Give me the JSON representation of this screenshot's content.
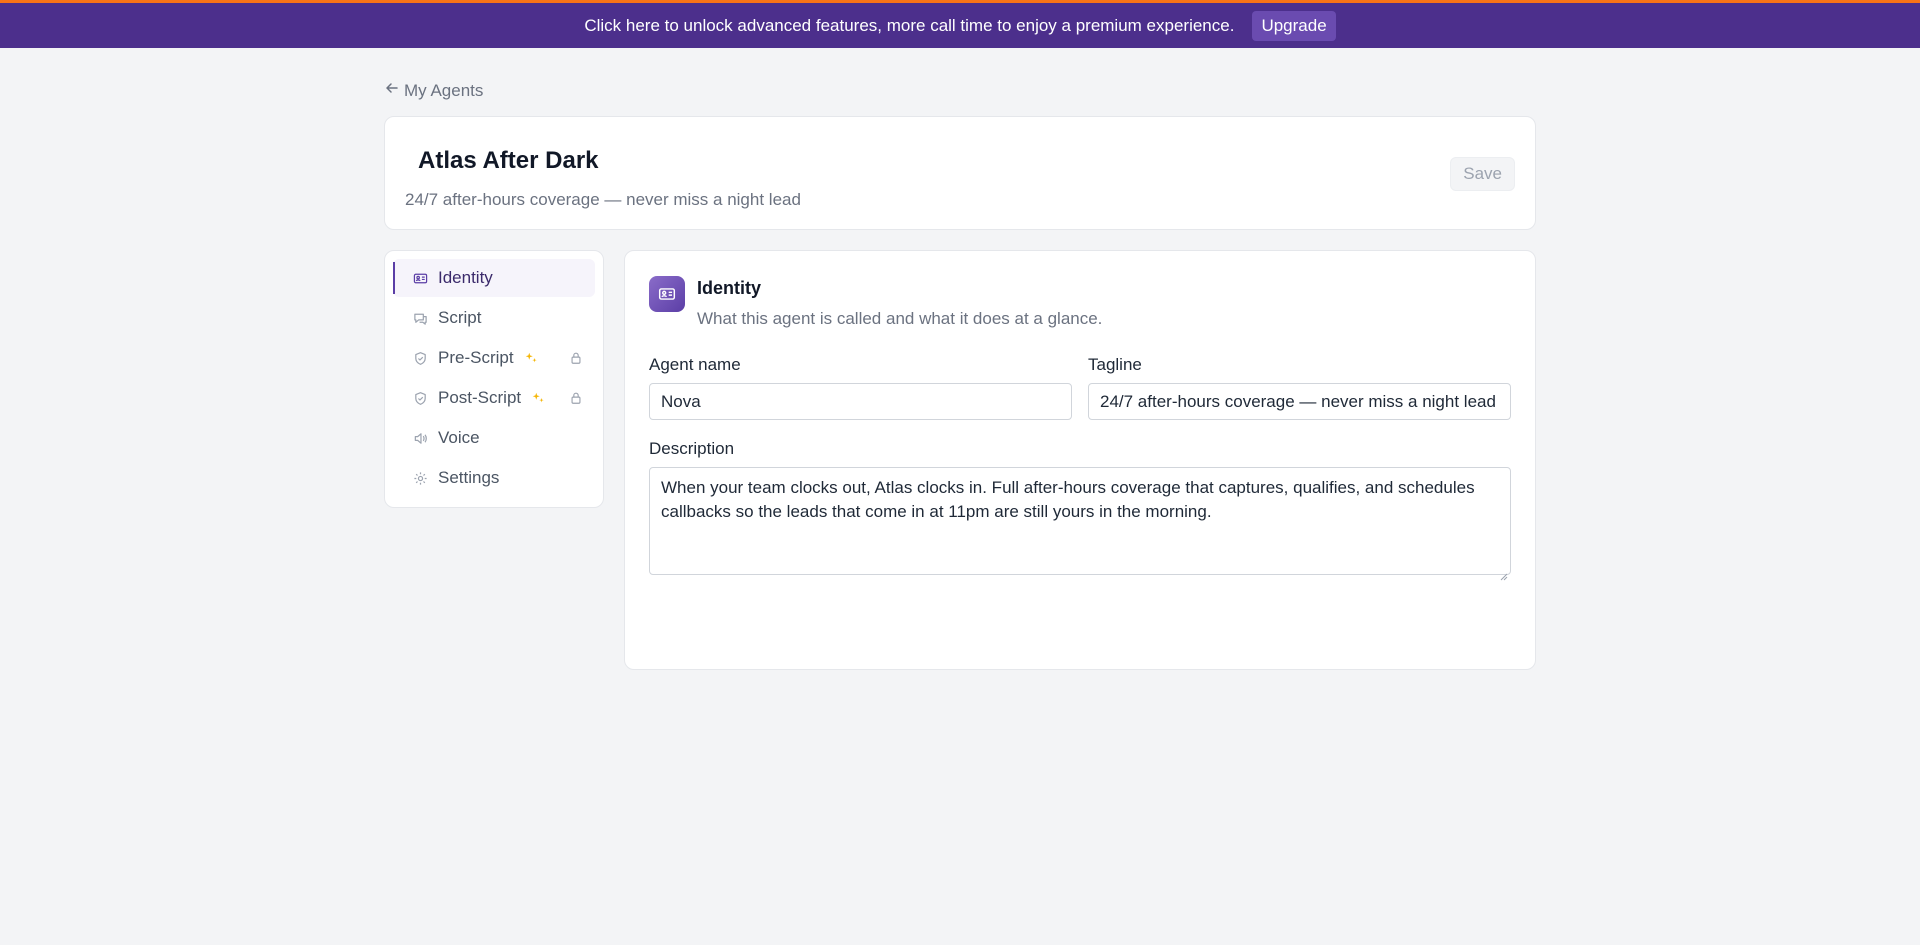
{
  "banner": {
    "message": "Click here to unlock advanced features, more call time to enjoy a premium experience.",
    "upgrade_label": "Upgrade"
  },
  "back_link": {
    "label": "My Agents",
    "icon": "arrow-left-icon"
  },
  "agent": {
    "title": "Atlas After Dark",
    "subtitle": "24/7 after-hours coverage — never miss a night lead",
    "save_label": "Save"
  },
  "sidebar": {
    "items": [
      {
        "label": "Identity",
        "icon": "id-card-icon",
        "active": true,
        "premium": false,
        "locked": false
      },
      {
        "label": "Script",
        "icon": "chat-icon",
        "active": false,
        "premium": false,
        "locked": false
      },
      {
        "label": "Pre-Script",
        "icon": "shield-icon",
        "active": false,
        "premium": true,
        "locked": true
      },
      {
        "label": "Post-Script",
        "icon": "shield-icon",
        "active": false,
        "premium": true,
        "locked": true
      },
      {
        "label": "Voice",
        "icon": "speaker-icon",
        "active": false,
        "premium": false,
        "locked": false
      },
      {
        "label": "Settings",
        "icon": "gear-icon",
        "active": false,
        "premium": false,
        "locked": false
      }
    ]
  },
  "identity": {
    "title": "Identity",
    "description": "What this agent is called and what it does at a glance.",
    "agent_name_label": "Agent name",
    "agent_name_value": "Nova",
    "tagline_label": "Tagline",
    "tagline_value": "24/7 after-hours coverage — never miss a night lead",
    "description_label": "Description",
    "description_value": "When your team clocks out, Atlas clocks in. Full after-hours coverage that captures, qualifies, and schedules callbacks so the leads that come in at 11pm are still yours in the morning."
  },
  "colors": {
    "banner_bg": "#4c2f8c",
    "accent": "#5b3ea6",
    "top_line": "#f97316",
    "premium_star": "#f5b70a"
  }
}
